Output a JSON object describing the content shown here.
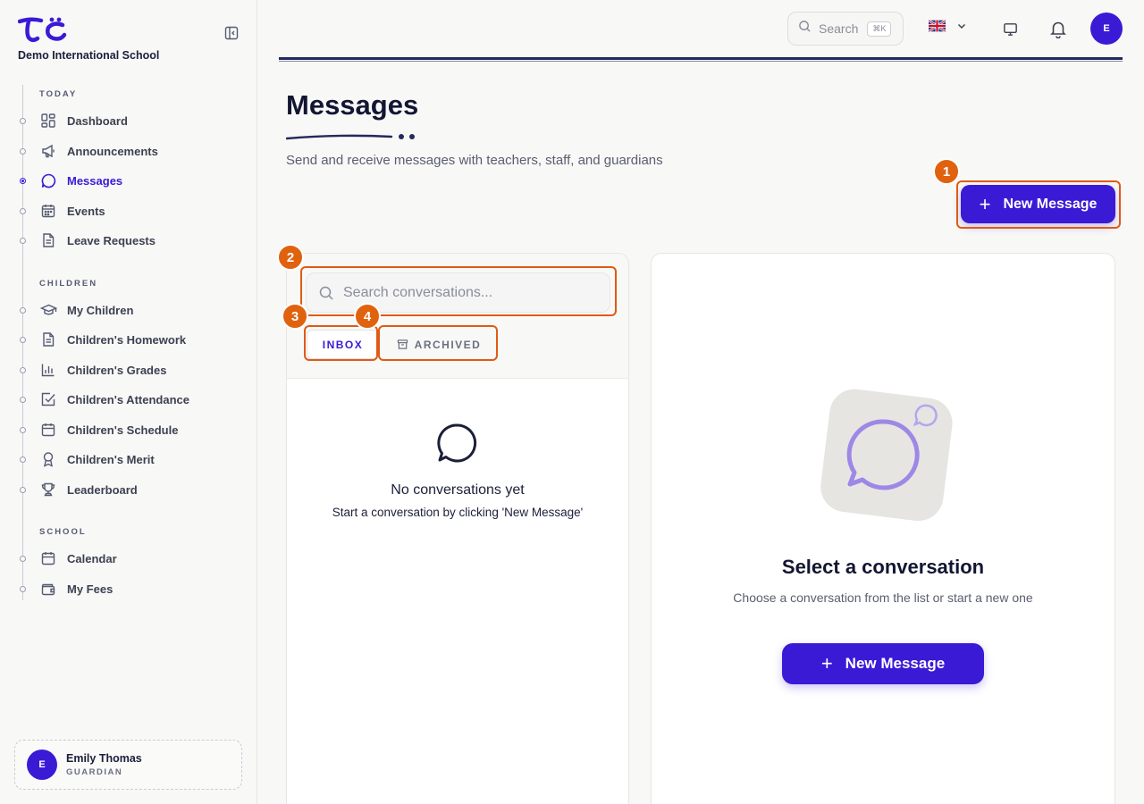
{
  "sidebar": {
    "school_name": "Demo International School",
    "sections": [
      {
        "title": "TODAY",
        "items": [
          {
            "label": "Dashboard",
            "icon": "dashboard-icon"
          },
          {
            "label": "Announcements",
            "icon": "megaphone-icon"
          },
          {
            "label": "Messages",
            "icon": "chat-bubble-icon",
            "active": true
          },
          {
            "label": "Events",
            "icon": "calendar-grid-icon"
          },
          {
            "label": "Leave Requests",
            "icon": "document-icon"
          }
        ]
      },
      {
        "title": "CHILDREN",
        "items": [
          {
            "label": "My Children",
            "icon": "graduation-cap-icon"
          },
          {
            "label": "Children's Homework",
            "icon": "document-icon"
          },
          {
            "label": "Children's Grades",
            "icon": "bar-chart-icon"
          },
          {
            "label": "Children's Attendance",
            "icon": "checkbox-icon"
          },
          {
            "label": "Children's Schedule",
            "icon": "calendar-icon"
          },
          {
            "label": "Children's Merit",
            "icon": "award-icon"
          },
          {
            "label": "Leaderboard",
            "icon": "trophy-icon"
          }
        ]
      },
      {
        "title": "SCHOOL",
        "items": [
          {
            "label": "Calendar",
            "icon": "calendar-icon"
          },
          {
            "label": "My Fees",
            "icon": "wallet-icon"
          }
        ]
      }
    ],
    "user": {
      "initial": "E",
      "name": "Emily Thomas",
      "role": "GUARDIAN"
    }
  },
  "topbar": {
    "search_placeholder": "Search",
    "search_shortcut": "⌘K",
    "user_initial": "E"
  },
  "page": {
    "title": "Messages",
    "subtitle": "Send and receive messages with teachers, staff, and guardians",
    "new_message_label": "New Message"
  },
  "conversations": {
    "search_placeholder": "Search conversations...",
    "tabs": {
      "inbox": "INBOX",
      "archived": "ARCHIVED"
    },
    "empty_title": "No conversations yet",
    "empty_subtitle": "Start a conversation by clicking 'New Message'"
  },
  "detail": {
    "title": "Select a conversation",
    "subtitle": "Choose a conversation from the list or start a new one",
    "new_message_label": "New Message"
  },
  "annotations": [
    "1",
    "2",
    "3",
    "4"
  ],
  "colors": {
    "accent": "#3b1ad6",
    "annotation": "#e0620f",
    "navy": "#232a5c"
  }
}
